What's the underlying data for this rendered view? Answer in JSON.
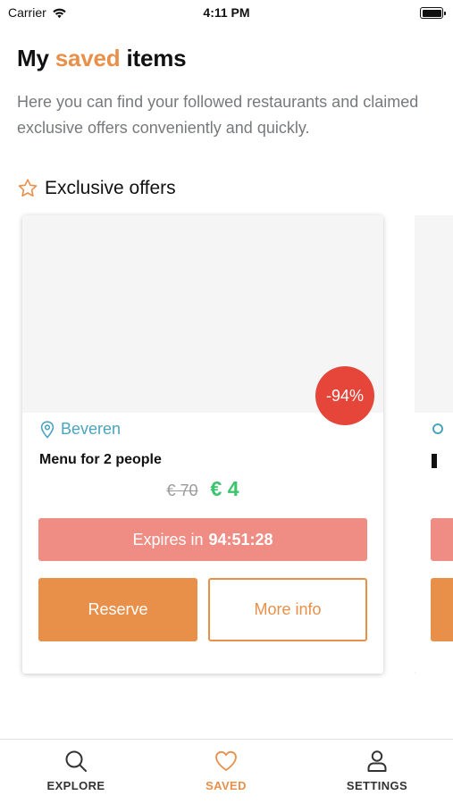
{
  "status_bar": {
    "carrier": "Carrier",
    "time": "4:11 PM"
  },
  "header": {
    "title_prefix": "My",
    "title_highlight": "saved",
    "title_suffix": "items",
    "description": "Here you can find your followed restaurants and claimed exclusive offers conveniently and quickly."
  },
  "section": {
    "icon": "star-icon",
    "label": "Exclusive offers"
  },
  "offers": [
    {
      "discount": "-94%",
      "location": "Beveren",
      "title": "Menu for 2 people",
      "old_price": "€ 70",
      "new_price": "€ 4",
      "expires_label": "Expires in",
      "expires_time": "94:51:28",
      "reserve_label": "Reserve",
      "more_info_label": "More info"
    }
  ],
  "tab_bar": {
    "tabs": [
      {
        "label": "EXPLORE",
        "icon": "search-icon",
        "active": false
      },
      {
        "label": "SAVED",
        "icon": "heart-icon",
        "active": true
      },
      {
        "label": "SETTINGS",
        "icon": "user-icon",
        "active": false
      }
    ]
  },
  "colors": {
    "accent": "#e8904a",
    "discount_badge": "#e6463a",
    "expires_bar": "#ef8d84",
    "location": "#4aa4bd",
    "new_price": "#3bc46e"
  }
}
